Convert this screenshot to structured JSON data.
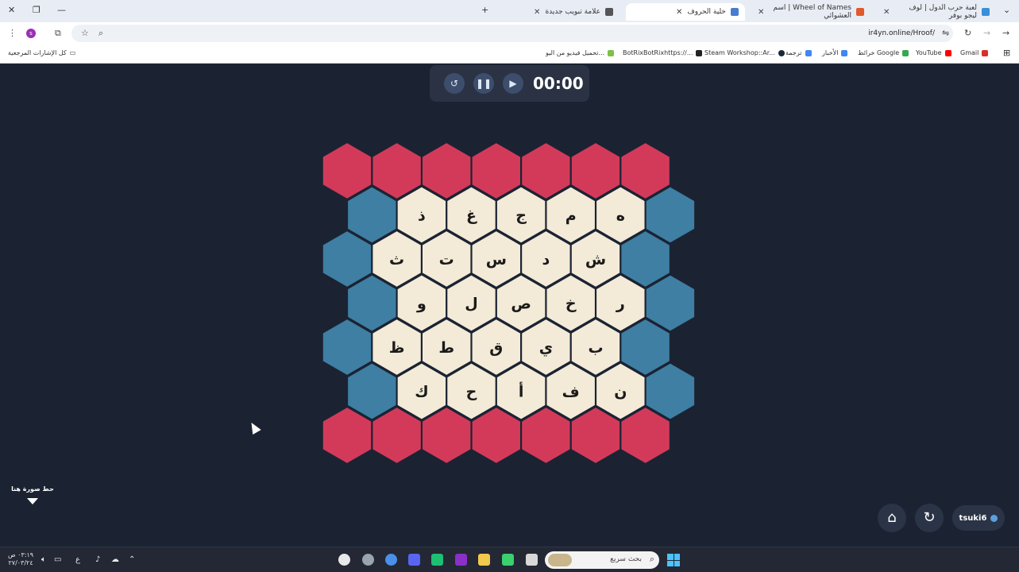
{
  "browser": {
    "tabs": [
      {
        "title": "لعبة حرب الدول | لوف ليجو بوفر",
        "active": false,
        "color": "#3a8fd9"
      },
      {
        "title": "Wheel of Names | اسم العشوائي",
        "active": false,
        "color": "#e05a2b"
      },
      {
        "title": "خلية الحروف",
        "active": true,
        "color": "#4a7bd0"
      },
      {
        "title": "علامة تبويب جديدة",
        "active": false,
        "color": "#555555"
      }
    ],
    "new_tab_label": "+",
    "url": "ir4yn.online/Hroof/",
    "profile_initial": "s",
    "bookmarks": [
      {
        "label": "Gmail",
        "color": "#d93025"
      },
      {
        "label": "YouTube",
        "color": "#ff0000"
      },
      {
        "label": "خرائط Google",
        "color": "#34a853"
      },
      {
        "label": "الأخبار",
        "color": "#4285f4"
      },
      {
        "label": "ترجمة",
        "color": "#4285f4"
      },
      {
        "label": "Steam Workshop::Ar...",
        "color": "#1b2838"
      },
      {
        "label": "BotRixBotRixhttps://...",
        "color": "#222222"
      },
      {
        "label": "تحميل فيديو من اليو...",
        "color": "#7cc04a"
      }
    ],
    "all_bookmarks_label": "كل الإشارات المرجعية"
  },
  "game": {
    "timer": "00:00",
    "colors": {
      "red": "#d33a5a",
      "blue": "#3e7fa3",
      "cream": "#f3ead7",
      "background": "#1b2333"
    },
    "board": {
      "top_row": [
        "red",
        "red",
        "red",
        "red",
        "red",
        "red",
        "red"
      ],
      "rows": [
        {
          "edge_left": "blue",
          "letters": [
            "ذ",
            "غ",
            "ج",
            "م",
            "ه"
          ],
          "edge_right": "blue"
        },
        {
          "edge_left": "blue",
          "letters": [
            "ث",
            "ت",
            "س",
            "د",
            "ش"
          ],
          "edge_right": "blue"
        },
        {
          "edge_left": "blue",
          "letters": [
            "و",
            "ل",
            "ص",
            "خ",
            "ر"
          ],
          "edge_right": "blue"
        },
        {
          "edge_left": "blue",
          "letters": [
            "ظ",
            "ط",
            "ق",
            "ي",
            "ب"
          ],
          "edge_right": "blue"
        },
        {
          "edge_left": "blue",
          "letters": [
            "ك",
            "ح",
            "أ",
            "ف",
            "ن"
          ],
          "edge_right": "blue"
        }
      ],
      "bottom_row": [
        "red",
        "red",
        "red",
        "red",
        "red",
        "red",
        "red"
      ]
    },
    "drop_image_label": "حط صورة هنا",
    "username": "tsuki6"
  },
  "icons": {
    "reset": "reset-icon",
    "pause": "pause-icon",
    "play": "play-icon",
    "home": "home-icon",
    "refresh": "refresh-icon",
    "user": "user-icon"
  },
  "taskbar": {
    "search_placeholder": "بحث سريع",
    "clock_time": "٠٣:١٩ ص",
    "clock_date": "٢٧/٠٣/٢٤",
    "lang": "ع"
  }
}
